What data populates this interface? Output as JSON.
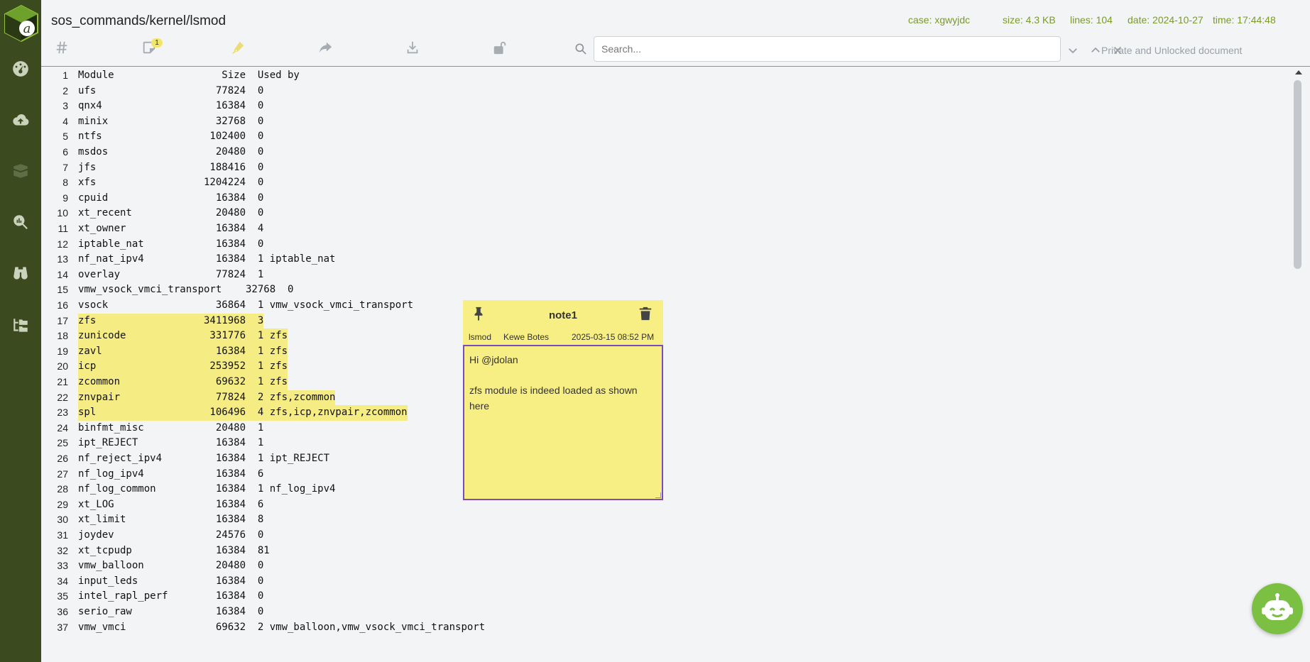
{
  "header": {
    "path": "sos_commands/kernel/lsmod",
    "case": "case: xgwyjdc",
    "size": "size: 4.3 KB",
    "lines": "lines: 104",
    "date": "date: 2024-10-27",
    "time": "time: 17:44:48"
  },
  "toolbar": {
    "notes_badge": "1",
    "search_placeholder": "Search...",
    "status_text": "Private and Unlocked document"
  },
  "lines": [
    {
      "n": "1",
      "text": "Module                  Size  Used by",
      "hl": false
    },
    {
      "n": "2",
      "text": "ufs                    77824  0",
      "hl": false
    },
    {
      "n": "3",
      "text": "qnx4                   16384  0",
      "hl": false
    },
    {
      "n": "4",
      "text": "minix                  32768  0",
      "hl": false
    },
    {
      "n": "5",
      "text": "ntfs                  102400  0",
      "hl": false
    },
    {
      "n": "6",
      "text": "msdos                  20480  0",
      "hl": false
    },
    {
      "n": "7",
      "text": "jfs                   188416  0",
      "hl": false
    },
    {
      "n": "8",
      "text": "xfs                  1204224  0",
      "hl": false
    },
    {
      "n": "9",
      "text": "cpuid                  16384  0",
      "hl": false
    },
    {
      "n": "10",
      "text": "xt_recent              20480  0",
      "hl": false
    },
    {
      "n": "11",
      "text": "xt_owner               16384  4",
      "hl": false
    },
    {
      "n": "12",
      "text": "iptable_nat            16384  0",
      "hl": false
    },
    {
      "n": "13",
      "text": "nf_nat_ipv4            16384  1 iptable_nat",
      "hl": false
    },
    {
      "n": "14",
      "text": "overlay                77824  1",
      "hl": false
    },
    {
      "n": "15",
      "text": "vmw_vsock_vmci_transport    32768  0",
      "hl": false
    },
    {
      "n": "16",
      "text": "vsock                  36864  1 vmw_vsock_vmci_transport",
      "hl": false
    },
    {
      "n": "17",
      "text": "zfs                  3411968  3",
      "hl": true
    },
    {
      "n": "18",
      "text": "zunicode              331776  1 zfs",
      "hl": true
    },
    {
      "n": "19",
      "text": "zavl                   16384  1 zfs",
      "hl": true
    },
    {
      "n": "20",
      "text": "icp                   253952  1 zfs",
      "hl": true
    },
    {
      "n": "21",
      "text": "zcommon                69632  1 zfs",
      "hl": true
    },
    {
      "n": "22",
      "text": "znvpair                77824  2 zfs,zcommon",
      "hl": true
    },
    {
      "n": "23",
      "text": "spl                   106496  4 zfs,icp,znvpair,zcommon",
      "hl": true
    },
    {
      "n": "24",
      "text": "binfmt_misc            20480  1",
      "hl": false
    },
    {
      "n": "25",
      "text": "ipt_REJECT             16384  1",
      "hl": false
    },
    {
      "n": "26",
      "text": "nf_reject_ipv4         16384  1 ipt_REJECT",
      "hl": false
    },
    {
      "n": "27",
      "text": "nf_log_ipv4            16384  6",
      "hl": false
    },
    {
      "n": "28",
      "text": "nf_log_common          16384  1 nf_log_ipv4",
      "hl": false
    },
    {
      "n": "29",
      "text": "xt_LOG                 16384  6",
      "hl": false
    },
    {
      "n": "30",
      "text": "xt_limit               16384  8",
      "hl": false
    },
    {
      "n": "31",
      "text": "joydev                 24576  0",
      "hl": false
    },
    {
      "n": "32",
      "text": "xt_tcpudp              16384  81",
      "hl": false
    },
    {
      "n": "33",
      "text": "vmw_balloon            20480  0",
      "hl": false
    },
    {
      "n": "34",
      "text": "input_leds             16384  0",
      "hl": false
    },
    {
      "n": "35",
      "text": "intel_rapl_perf        16384  0",
      "hl": false
    },
    {
      "n": "36",
      "text": "serio_raw              16384  0",
      "hl": false
    },
    {
      "n": "37",
      "text": "vmw_vmci               69632  2 vmw_balloon,vmw_vsock_vmci_transport",
      "hl": false
    }
  ],
  "note": {
    "title": "note1",
    "file": "lsmod",
    "author": "Kewe Botes",
    "timestamp": "2025-03-15 08:52 PM",
    "body": "Hi @jdolan\n\nzfs module is indeed loaded as shown here"
  },
  "colors": {
    "sidebar": "#3b4a1f",
    "accent": "#7a9a2a",
    "highlight": "#f6ec84",
    "note": "#f8ef84",
    "note_border": "#7b4cc0"
  }
}
